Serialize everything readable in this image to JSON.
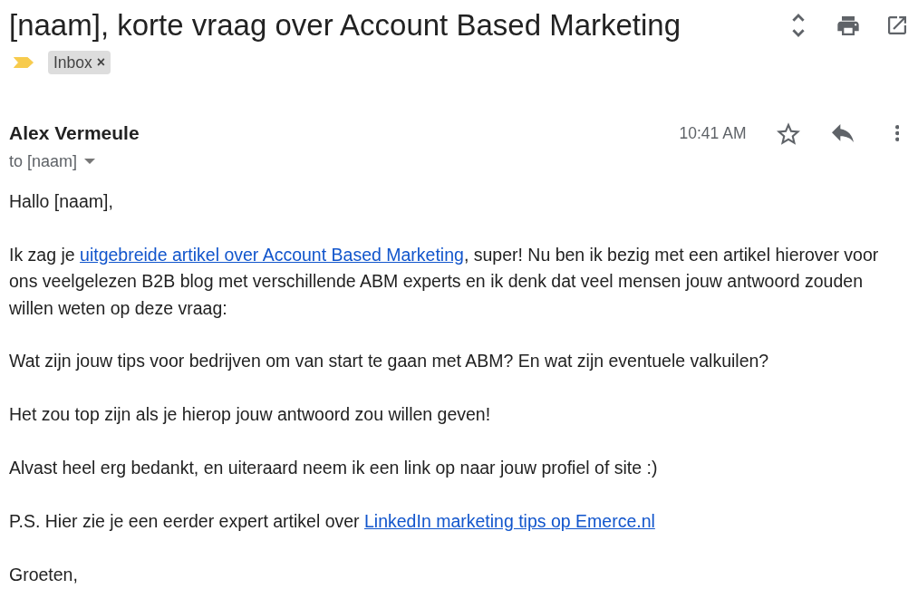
{
  "subject": {
    "title": "[naam], korte vraag over Account Based Marketing"
  },
  "important": true,
  "labels": [
    {
      "text": "Inbox",
      "remove": "×"
    }
  ],
  "message": {
    "sender": "Alex Vermeule",
    "recipient": "to [naam]",
    "time": "10:41 AM",
    "starred": false
  },
  "body": {
    "paragraphs": [
      {
        "parts": [
          {
            "kind": "text",
            "text": "Hallo [naam],"
          }
        ]
      },
      {
        "parts": [
          {
            "kind": "text",
            "text": "Ik zag je "
          },
          {
            "kind": "link",
            "text": "uitgebreide artikel over Account Based Marketing"
          },
          {
            "kind": "text",
            "text": ", super! Nu ben ik bezig met een artikel hierover voor ons veelgelezen B2B blog met verschillende ABM experts en ik denk dat veel mensen jouw antwoord zouden willen weten op deze vraag:"
          }
        ]
      },
      {
        "parts": [
          {
            "kind": "text",
            "text": "Wat zijn jouw tips voor bedrijven om van start te gaan met ABM? En wat zijn eventuele valkuilen?"
          }
        ]
      },
      {
        "parts": [
          {
            "kind": "text",
            "text": "Het zou top zijn als je hierop jouw antwoord zou willen geven!"
          }
        ]
      },
      {
        "parts": [
          {
            "kind": "text",
            "text": "Alvast heel erg bedankt, en uiteraard neem ik een link op naar jouw profiel of site :)"
          }
        ]
      },
      {
        "parts": [
          {
            "kind": "text",
            "text": "P.S. Hier zie je een eerder expert artikel over "
          },
          {
            "kind": "link",
            "text": "LinkedIn marketing tips op Emerce.nl"
          }
        ]
      },
      {
        "parts": [
          {
            "kind": "text",
            "text": "Groeten,"
          }
        ]
      }
    ]
  }
}
